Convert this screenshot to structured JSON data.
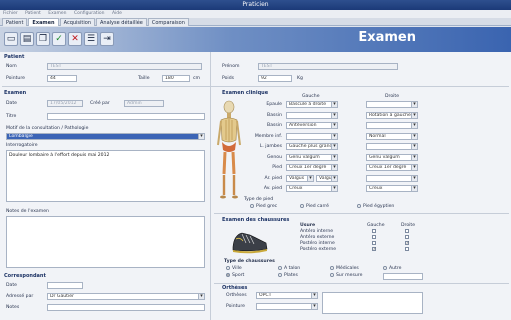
{
  "window": {
    "title": "Praticien"
  },
  "menu": [
    "Fichier",
    "Patient",
    "Examen",
    "Configuration",
    "Aide"
  ],
  "tabs": [
    "Patient",
    "Examen",
    "Acquisition",
    "Analyse détaillée",
    "Comparaison"
  ],
  "toolbar": {
    "title": "Examen"
  },
  "patient": {
    "section": "Patient",
    "nom_label": "Nom",
    "nom_value": "TEST",
    "prenom_label": "Prénom",
    "prenom_value": "TEST",
    "pointure_label": "Pointure",
    "pointure_value": "44",
    "taille_label": "Taille",
    "taille_value": "180",
    "taille_unit": "cm",
    "poids_label": "Poids",
    "poids_value": "92",
    "poids_unit": "Kg"
  },
  "examen": {
    "section": "Examen",
    "date_label": "Date",
    "date_value": "17/05/2012",
    "cree_label": "Créé par",
    "cree_value": "Admin",
    "titre_label": "Titre",
    "motif_label": "Motif de la consultation / Pathologie",
    "motif_value": "Lombalgie",
    "interrogatoire_label": "Interrogatoire",
    "interrogatoire_value": "Douleur lombaire à l'effort depuis mai 2012",
    "notes_label": "Notes de l'examen"
  },
  "correspondant": {
    "section": "Correspondant",
    "date_label": "Date",
    "adresse_label": "Adressé par",
    "adresse_value": "Dr Gautier",
    "notes_label": "Notes"
  },
  "clinique": {
    "section": "Examen clinique",
    "col_gauche": "Gauche",
    "col_droite": "Droite",
    "rows": [
      {
        "label": "Epaule",
        "gauche": "Bascule à droite",
        "droite": ""
      },
      {
        "label": "Bassin",
        "gauche": "",
        "droite": "Rotation à gauche"
      },
      {
        "label": "Bassin",
        "gauche": "Antéversion",
        "droite": ""
      },
      {
        "label": "Membre inf.",
        "gauche": "",
        "droite": "Normal"
      },
      {
        "label": "L. jambes",
        "gauche": "Gauche plus grande",
        "droite": ""
      },
      {
        "label": "Genou",
        "gauche": "Genu valgum",
        "droite": "Genu valgum"
      },
      {
        "label": "Pied",
        "gauche": "Creux 1er degré",
        "droite": "Creux 1er degré"
      },
      {
        "label": "Ar. pied",
        "gauche": "Valgus",
        "gauche2": "Valgus",
        "droite": ""
      },
      {
        "label": "Av. pied",
        "gauche": "Creux",
        "droite": "Creux"
      }
    ],
    "type_pied_label": "Type de pied",
    "type_pied_options": [
      "Pied grec",
      "Pied carré",
      "Pied égyptien"
    ]
  },
  "chaussures": {
    "section": "Examen des chaussures",
    "usure_label": "Usure",
    "col_gauche": "Gauche",
    "col_droite": "Droite",
    "usure_rows": [
      "Antéro interne",
      "Antéro externe",
      "Postéro interne",
      "Postéro externe"
    ],
    "usure_gauche": [
      false,
      false,
      false,
      true
    ],
    "usure_droite": [
      false,
      false,
      true,
      false
    ],
    "type_label": "Type de chaussures",
    "type_options": [
      "Ville",
      "Sport",
      "A talon",
      "Plates",
      "Médicales",
      "Sur mesure",
      "Autre"
    ]
  },
  "ortheses": {
    "section": "Orthèses",
    "ortheses_label": "Orthèses",
    "ortheses_value": "OPCT",
    "pointure_label": "Pointure"
  },
  "colors": {
    "accent": "#3a64b0",
    "titlebar": "#1c3a78"
  }
}
